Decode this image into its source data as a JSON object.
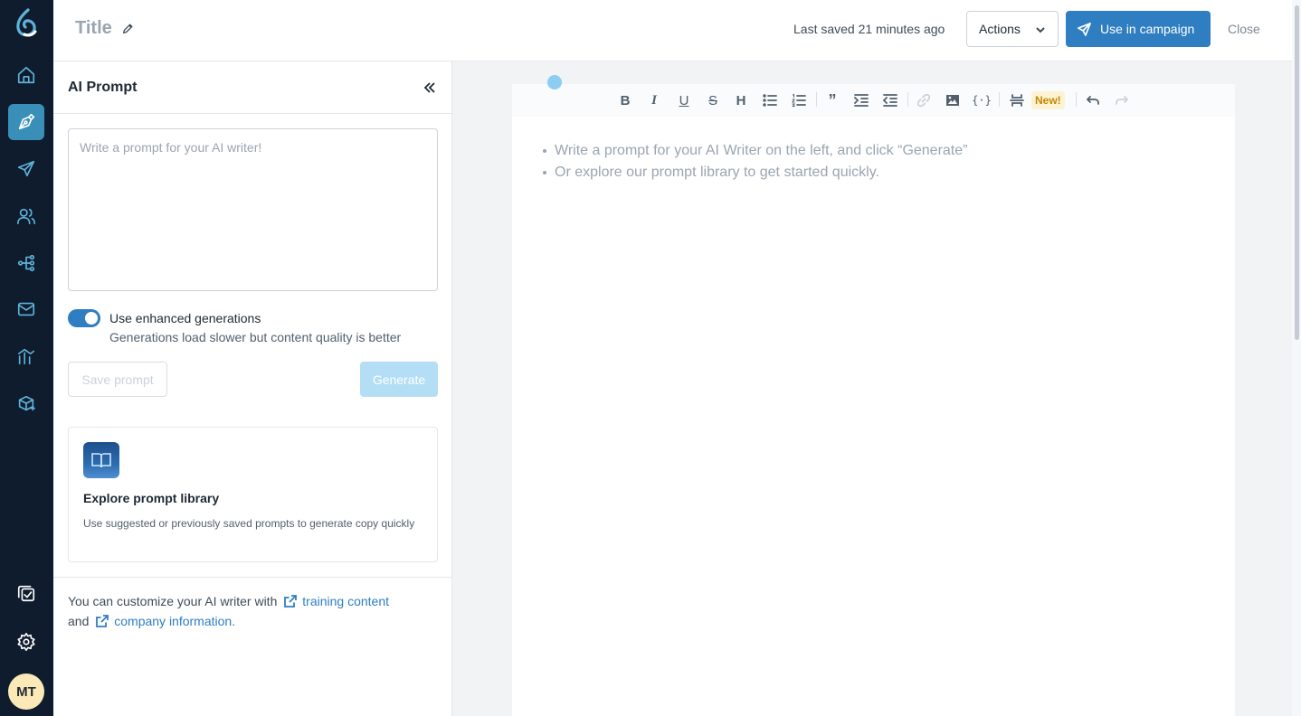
{
  "header": {
    "title": "Title",
    "last_saved": "Last saved 21 minutes ago",
    "actions_label": "Actions",
    "campaign_label": "Use in campaign",
    "close_label": "Close"
  },
  "nav": {
    "items": [
      "home-icon",
      "pen-nib-icon",
      "send-icon",
      "users-icon",
      "workflow-icon",
      "mail-icon",
      "analytics-icon",
      "package-add-icon",
      "tasks-icon",
      "gear-icon"
    ],
    "avatar_initials": "MT"
  },
  "panel": {
    "title": "AI Prompt",
    "prompt_placeholder": "Write a prompt for your AI writer!",
    "toggle_label": "Use enhanced generations",
    "toggle_help": "Generations load slower but content quality is better",
    "toggle_on": true,
    "save_prompt_label": "Save prompt",
    "generate_label": "Generate",
    "library_title": "Explore prompt library",
    "library_desc": "Use suggested or previously saved prompts to generate copy quickly",
    "footer_prefix": "You can customize your AI writer with",
    "footer_link1": "training content",
    "footer_and": "and",
    "footer_link2": "company information."
  },
  "editor": {
    "new_badge": "New!",
    "hints": [
      "Write a prompt for your AI Writer on the left, and click “Generate”",
      "Or explore our prompt library to get started quickly."
    ]
  },
  "colors": {
    "nav_bg": "#0f1c2e",
    "accent": "#2f7ec1",
    "nav_icon": "#5fb3d9",
    "generate_disabled": "#b3def5"
  }
}
